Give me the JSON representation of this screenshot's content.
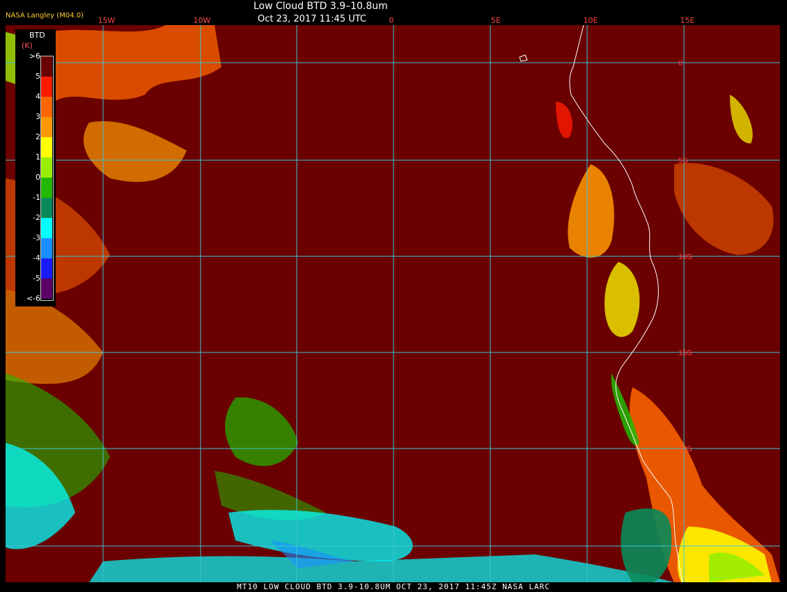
{
  "header": {
    "brand": "NASA Langley (M04.0)",
    "title": "Low Cloud BTD 3.9–10.8um",
    "subtitle": "Oct 23, 2017 11:45 UTC",
    "top_labels": [
      "15W",
      "10W",
      "0",
      "5E",
      "10E",
      "15E"
    ]
  },
  "map": {
    "background_color": "#6a0000",
    "grid_color": "#39c6d6",
    "coast_color": "#ffffff",
    "lat_labels": [
      "0",
      "5S",
      "10S",
      "15S",
      "20S"
    ]
  },
  "legend": {
    "title": "BTD",
    "unit": "(K)",
    "ticks": [
      ">6",
      "5",
      "4",
      "3",
      "2",
      "1",
      "0",
      "-1",
      "-2",
      "-3",
      "-4",
      "-5",
      "<-6"
    ],
    "colors": [
      "#6a0000",
      "#ff1a00",
      "#ff6600",
      "#ff9900",
      "#ffff00",
      "#99ee00",
      "#22b800",
      "#0a8a5a",
      "#00ffff",
      "#1a8fff",
      "#1a1aff",
      "#5a0066"
    ]
  },
  "footer": {
    "text": "MT10   LOW CLOUD BTD 3.9-10.8UM   OCT 23, 2017 11:45Z   NASA LARC"
  }
}
